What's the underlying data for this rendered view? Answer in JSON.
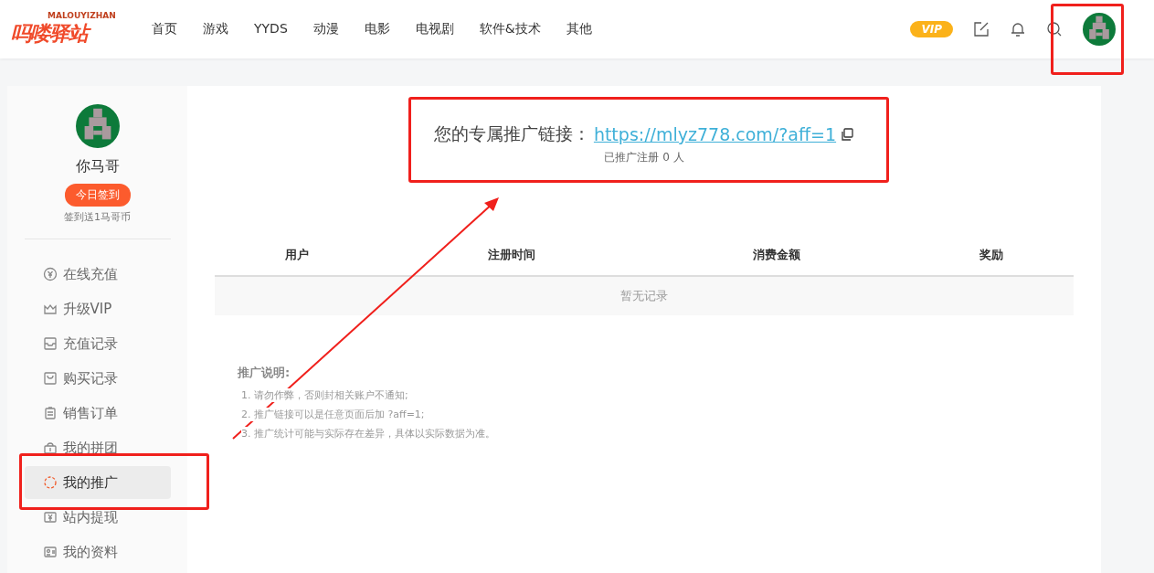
{
  "header": {
    "logo": {
      "title": "吗喽驿站",
      "subtitle": "MALOUYIZHAN"
    },
    "nav": [
      "首页",
      "游戏",
      "YYDS",
      "动漫",
      "电影",
      "电视剧",
      "软件&技术",
      "其他"
    ],
    "vip_badge": "VIP"
  },
  "sidebar": {
    "user": {
      "name": "你马哥",
      "checkin_button": "今日签到",
      "checkin_note": "签到送1马哥币"
    },
    "items": [
      {
        "label": "在线充值",
        "selected": false
      },
      {
        "label": "升级VIP",
        "selected": false
      },
      {
        "label": "充值记录",
        "selected": false
      },
      {
        "label": "购买记录",
        "selected": false
      },
      {
        "label": "销售订单",
        "selected": false
      },
      {
        "label": "我的拼团",
        "selected": false
      },
      {
        "label": "我的推广",
        "selected": true
      },
      {
        "label": "站内提现",
        "selected": false
      },
      {
        "label": "我的资料",
        "selected": false
      }
    ]
  },
  "referral": {
    "label": "您的专属推广链接：",
    "link": "https://mlyz778.com/?aff=1",
    "count": "已推广注册 0 人"
  },
  "table": {
    "columns": [
      "用户",
      "注册时间",
      "消费金额",
      "奖励"
    ],
    "empty": "暂无记录"
  },
  "notes": {
    "title": "推广说明:",
    "items": [
      "1. 请勿作弊，否则封相关账户不通知;",
      "2. 推广链接可以是任意页面后加 ?aff=1;",
      "3. 推广统计可能与实际存在差异，具体以实际数据为准。"
    ]
  }
}
